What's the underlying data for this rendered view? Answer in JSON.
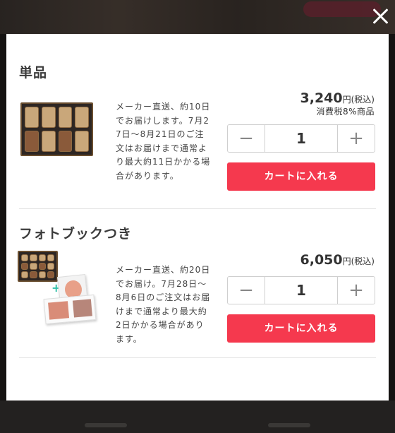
{
  "sections": [
    {
      "title": "単品",
      "description": "メーカー直送、約10日でお届けします。7月27日〜8月21日のご注文はお届けまで通常より最大約11日かかる場合があります。",
      "price": "3,240",
      "price_suffix": "円(税込)",
      "tax_note": "消費税8%商品",
      "quantity": "1",
      "cart_label": "カートに入れる"
    },
    {
      "title": "フォトブックつき",
      "description": "メーカー直送、約20日でお届け。7月28日〜8月6日のご注文はお届けまで通常より最大約2日かかる場合があります。",
      "price": "6,050",
      "price_suffix": "円(税込)",
      "quantity": "1",
      "cart_label": "カートに入れる"
    }
  ],
  "stepper": {
    "minus": "−",
    "plus": "+"
  },
  "icons": {
    "close": "close-icon",
    "plus_badge": "plus-icon"
  },
  "colors": {
    "cart_button": "#f5394e",
    "close_icon": "#ffffff"
  }
}
